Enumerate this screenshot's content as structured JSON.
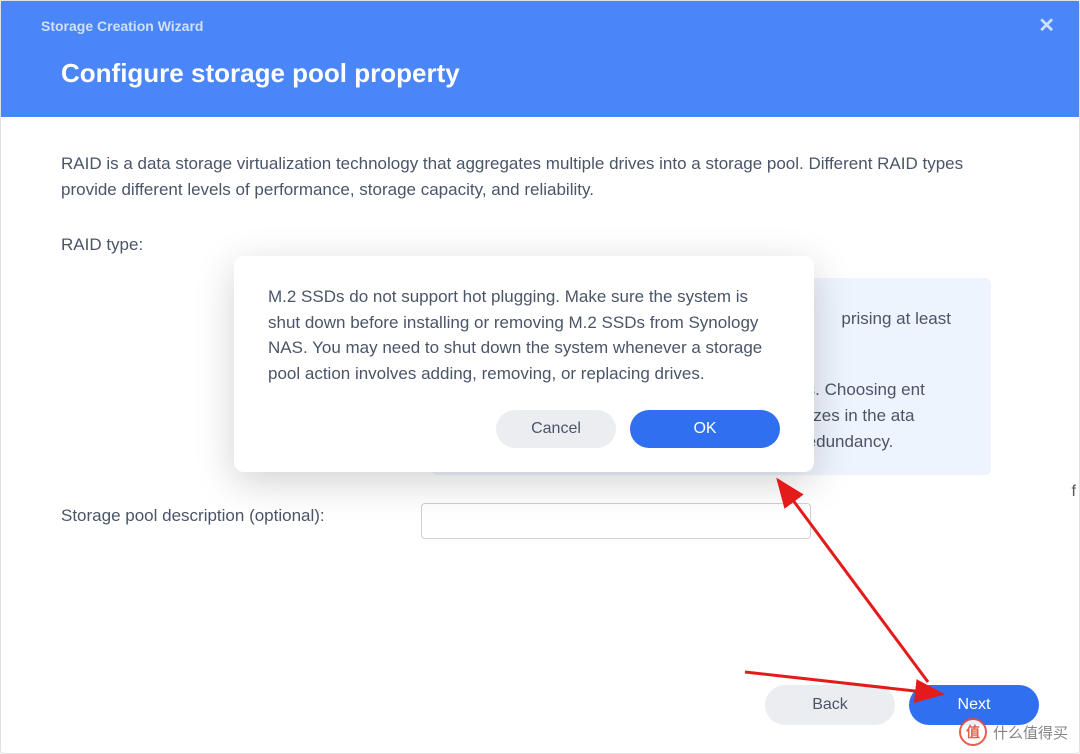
{
  "header": {
    "wizard_label": "Storage Creation Wizard",
    "title": "Configure storage pool property"
  },
  "content": {
    "intro": "RAID is a data storage virtualization technology that aggregates multiple drives into a storage pool. Different RAID types provide different levels of performance, storage capacity, and reliability.",
    "raid_type_label": "RAID type:",
    "info_item_1_partial": "prising at least",
    "info_item_2_partial": "rs. Choosing ent sizes in the ata redundancy.",
    "desc_label": "Storage pool description (optional):",
    "desc_value": ""
  },
  "modal": {
    "text": "M.2 SSDs do not support hot plugging. Make sure the system is shut down before installing or removing M.2 SSDs from Synology NAS. You may need to shut down the system whenever a storage pool action involves adding, removing, or replacing drives.",
    "cancel_label": "Cancel",
    "ok_label": "OK"
  },
  "footer": {
    "back_label": "Back",
    "next_label": "Next"
  },
  "watermark": {
    "badge": "值",
    "text": "什么值得买"
  },
  "side_char": "f"
}
